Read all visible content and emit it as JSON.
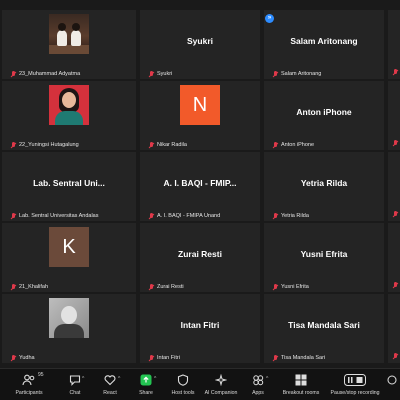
{
  "indicator": "»",
  "tiles": [
    {
      "kind": "photo-group",
      "name": "",
      "label": "23_Muhammad Adyatma"
    },
    {
      "kind": "name",
      "name": "Syukri",
      "label": "Syukri"
    },
    {
      "kind": "name",
      "name": "Salam Aritonang",
      "label": "Salam Aritonang"
    },
    {
      "kind": "photo-woman",
      "name": "",
      "label": "22_Yuningsi Hutagalung"
    },
    {
      "kind": "initial",
      "initial": "N",
      "color": "#f25a2a",
      "name": "",
      "label": "Nikar Radila"
    },
    {
      "kind": "name",
      "name": "Anton iPhone",
      "label": "Anton iPhone"
    },
    {
      "kind": "name",
      "name": "Lab. Sentral Uni...",
      "label": "Lab. Sentral Universitas Andalas"
    },
    {
      "kind": "name",
      "name": "A. I. BAQI - FMIP...",
      "label": "A. I. BAQI - FMIPA Unand"
    },
    {
      "kind": "name",
      "name": "Yetria Rilda",
      "label": "Yetria Rilda"
    },
    {
      "kind": "initial",
      "initial": "K",
      "color": "#6b4a3a",
      "name": "",
      "label": "21_Khalifah"
    },
    {
      "kind": "name",
      "name": "Zurai Resti",
      "label": "Zurai Resti"
    },
    {
      "kind": "name",
      "name": "Yusni Efrita",
      "label": "Yusni Efrita"
    },
    {
      "kind": "photo-gray",
      "name": "",
      "label": "Yudha"
    },
    {
      "kind": "name",
      "name": "Intan Fitri",
      "label": "Intan Fitri"
    },
    {
      "kind": "name",
      "name": "Tisa Mandala Sari",
      "label": "Tisa Mandala Sari"
    }
  ],
  "toolbar": {
    "participants_count": "95",
    "participants": "Participants",
    "chat": "Chat",
    "react": "React",
    "share": "Share",
    "host_tools": "Host tools",
    "ai_companion": "AI Companion",
    "apps": "Apps",
    "breakout_rooms": "Breakout rooms",
    "recording": "Pause/stop recording"
  },
  "colors": {
    "background": "#1a1a1a",
    "tile": "#242424",
    "muted_mic": "#e0394a",
    "share_green": "#23c552"
  }
}
